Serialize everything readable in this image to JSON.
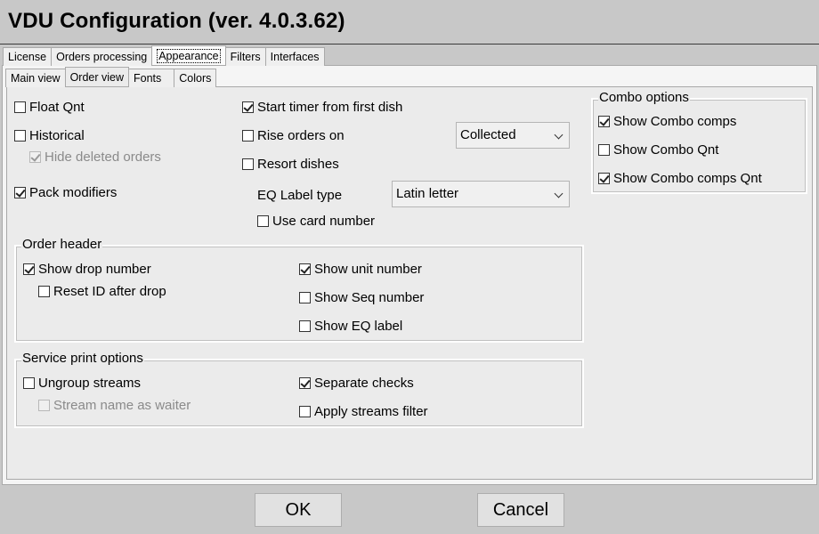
{
  "window": {
    "title": "VDU Configuration (ver. 4.0.3.62)"
  },
  "main_tabs": [
    {
      "label": "License"
    },
    {
      "label": "Orders processing"
    },
    {
      "label": "Appearance"
    },
    {
      "label": "Filters"
    },
    {
      "label": "Interfaces"
    }
  ],
  "sub_tabs": [
    {
      "label": "Main view"
    },
    {
      "label": "Order view"
    },
    {
      "label": "Fonts"
    },
    {
      "label": "Colors"
    }
  ],
  "options": {
    "float_qnt": {
      "label": "Float Qnt",
      "checked": false
    },
    "historical": {
      "label": "Historical",
      "checked": false
    },
    "hide_deleted_orders": {
      "label": "Hide deleted orders",
      "checked": true,
      "enabled": false
    },
    "pack_modifiers": {
      "label": "Pack modifiers",
      "checked": true
    },
    "start_timer": {
      "label": "Start timer from first dish",
      "checked": true
    },
    "rise_orders_on": {
      "label": "Rise orders on",
      "checked": false
    },
    "resort_dishes": {
      "label": "Resort dishes",
      "checked": false
    },
    "eq_label_type": {
      "label": "EQ Label type"
    },
    "use_card_number": {
      "label": "Use card number",
      "checked": false
    },
    "rise_select": {
      "value": "Collected"
    },
    "eq_select": {
      "value": "Latin letter"
    }
  },
  "combo": {
    "title": "Combo options",
    "show_combo_comps": {
      "label": "Show Combo comps",
      "checked": true
    },
    "show_combo_qnt": {
      "label": "Show Combo Qnt",
      "checked": false
    },
    "show_combo_comps_qnt": {
      "label": "Show Combo comps Qnt",
      "checked": true
    }
  },
  "order_header": {
    "title": "Order header",
    "show_drop_number": {
      "label": "Show drop number",
      "checked": true
    },
    "reset_id_after_drop": {
      "label": "Reset ID after drop",
      "checked": false
    },
    "show_unit_number": {
      "label": "Show unit number",
      "checked": true
    },
    "show_seq_number": {
      "label": "Show Seq number",
      "checked": false
    },
    "show_eq_label": {
      "label": "Show EQ label",
      "checked": false
    }
  },
  "service_print": {
    "title": "Service print options",
    "ungroup_streams": {
      "label": "Ungroup streams",
      "checked": false
    },
    "stream_name_as_waiter": {
      "label": "Stream name as waiter",
      "checked": false,
      "enabled": false
    },
    "separate_checks": {
      "label": "Separate checks",
      "checked": true
    },
    "apply_streams_filter": {
      "label": "Apply streams filter",
      "checked": false
    }
  },
  "buttons": {
    "ok": "OK",
    "cancel": "Cancel"
  }
}
